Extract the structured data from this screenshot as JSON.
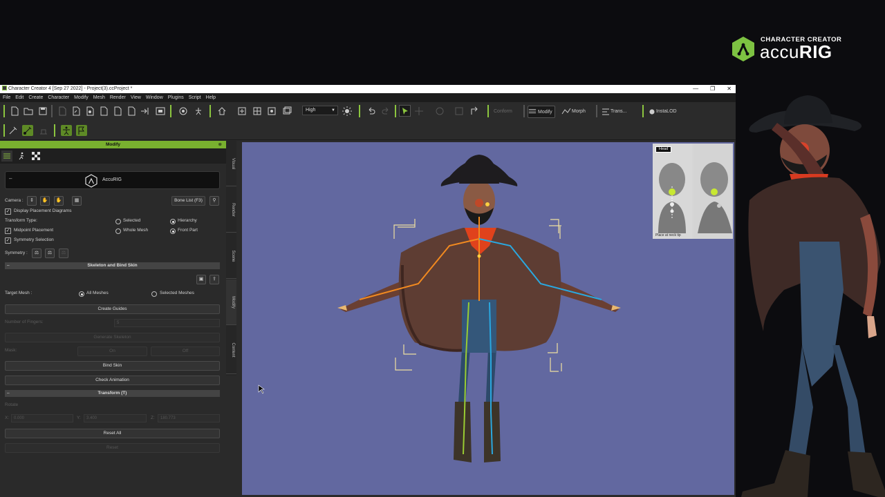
{
  "brand": {
    "super": "CHARACTER CREATOR",
    "name_light": "accu",
    "name_bold": "RIG",
    "accent": "#7dc242"
  },
  "window": {
    "title": "Character Creator 4 [Sep 27 2022] - Project(3).ccProject *",
    "controls": [
      "—",
      "❐",
      "✕"
    ]
  },
  "menu": [
    "File",
    "Edit",
    "Create",
    "Character",
    "Modify",
    "Mesh",
    "Render",
    "View",
    "Window",
    "Plugins",
    "Script",
    "Help"
  ],
  "toolbar": {
    "quality": "High",
    "conform": "Conform",
    "modify": "Modify",
    "morph": "Morph",
    "trans": "Trans...",
    "instalod": "InstaLOD"
  },
  "panel": {
    "title": "Modify",
    "close": "⊗",
    "accurig_label": "AccuRIG",
    "accurig_min": "–",
    "camera_label": "Camera :",
    "bone_list": "Bone List (F3)",
    "display_placement": "Display Placement Diagrams",
    "transform_type": "Transform Type:",
    "selected": "Selected",
    "whole_mesh": "Whole Mesh",
    "hierarchy": "Hierarchy",
    "front_part": "Front Part",
    "midpoint": "Midpoint Placement",
    "symmetry_sel": "Symmetry Selection",
    "symmetry": "Symmetry :",
    "skeleton_section": "Skeleton and Bind Skin",
    "section_minus": "–",
    "target_mesh": "Target Mesh :",
    "all_meshes": "All Meshes",
    "selected_meshes": "Selected Meshes",
    "create_guides": "Create Guides",
    "num_fingers": "Number of Fingers:",
    "num_fingers_val": "5",
    "gen_skeleton": "Generate Skeleton",
    "mask": "Mask:",
    "on": "On",
    "off": "Off",
    "bind_skin": "Bind Skin",
    "check_animation": "Check Animation",
    "transform_section": "Transform (T)",
    "rotate": "Rotate",
    "x_label": "X:",
    "x_val": "0.000",
    "y_label": "Y:",
    "y_val": "3.400",
    "z_label": "Z:",
    "z_val": "180.773",
    "reset_all": "Reset All",
    "reset": "Reset"
  },
  "side_tabs": [
    "Visual",
    "Render",
    "Scene",
    "Modify",
    "Content"
  ],
  "viewport": {
    "background": "#6268a0",
    "inset_tag": "Head",
    "inset_caption": "Place at neck tip"
  }
}
